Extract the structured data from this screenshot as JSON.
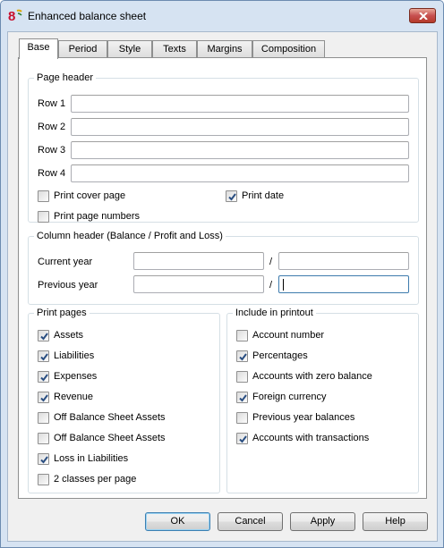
{
  "window": {
    "title": "Enhanced balance sheet"
  },
  "tabs": [
    "Base",
    "Period",
    "Style",
    "Texts",
    "Margins",
    "Composition"
  ],
  "page_header": {
    "title": "Page header",
    "rows": [
      {
        "label": "Row 1",
        "value": ""
      },
      {
        "label": "Row 2",
        "value": ""
      },
      {
        "label": "Row 3",
        "value": ""
      },
      {
        "label": "Row 4",
        "value": ""
      }
    ],
    "print_cover_page": {
      "label": "Print cover page",
      "checked": false
    },
    "print_date": {
      "label": "Print date",
      "checked": true
    },
    "print_page_numbers": {
      "label": "Print page numbers",
      "checked": false
    }
  },
  "column_header": {
    "title": "Column header (Balance / Profit and Loss)",
    "current_year": {
      "label": "Current year",
      "value1": "",
      "value2": ""
    },
    "previous_year": {
      "label": "Previous year",
      "value1": "",
      "value2": ""
    },
    "separator": "/"
  },
  "print_pages": {
    "title": "Print pages",
    "items": [
      {
        "label": "Assets",
        "checked": true
      },
      {
        "label": "Liabilities",
        "checked": true
      },
      {
        "label": "Expenses",
        "checked": true
      },
      {
        "label": "Revenue",
        "checked": true
      },
      {
        "label": "Off Balance Sheet Assets",
        "checked": false
      },
      {
        "label": "Off Balance Sheet Assets",
        "checked": false
      },
      {
        "label": "Loss in Liabilities",
        "checked": true
      },
      {
        "label": "2 classes per page",
        "checked": false
      }
    ]
  },
  "include_in_printout": {
    "title": "Include in printout",
    "items": [
      {
        "label": "Account number",
        "checked": false
      },
      {
        "label": "Percentages",
        "checked": true
      },
      {
        "label": "Accounts with zero balance",
        "checked": false
      },
      {
        "label": "Foreign currency",
        "checked": true
      },
      {
        "label": "Previous year balances",
        "checked": false
      },
      {
        "label": "Accounts with transactions",
        "checked": true
      }
    ]
  },
  "buttons": {
    "ok": "OK",
    "cancel": "Cancel",
    "apply": "Apply",
    "help": "Help"
  },
  "colors": {
    "title_bar": "#d6e3f2",
    "check_mark": "#2b4f82",
    "close_button": "#c75050"
  },
  "icons": {
    "app": "banana-app-icon",
    "close": "close-icon",
    "check": "check-icon"
  }
}
